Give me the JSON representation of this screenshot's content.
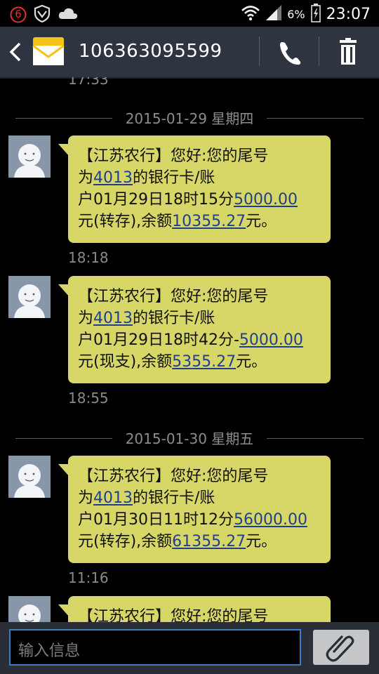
{
  "status_bar": {
    "notification_count": "6",
    "battery_percent": "6%",
    "time": "23:07"
  },
  "header": {
    "sender": "106363095599"
  },
  "conversation": {
    "top_time_partial": "17:33",
    "date_1": "2015-01-29 星期四",
    "date_2": "2015-01-30 星期五",
    "messages": [
      {
        "l1": "【江苏农行】您好:您的尾号",
        "l2_pre": "为",
        "card": "4013",
        "l2_post": "的银行卡/账",
        "l3_pre": "户01月29日18时15分",
        "amount": "5000.00",
        "l4_pre": "元(转存),余额",
        "balance": "10355.27",
        "l4_post": "元。",
        "time": "18:18"
      },
      {
        "l1": "【江苏农行】您好:您的尾号",
        "l2_pre": "为",
        "card": "4013",
        "l2_post": "的银行卡/账",
        "l3_pre": "户01月29日18时42分-",
        "amount": "5000.00",
        "l4_pre": "元(现支),余额",
        "balance": "5355.27",
        "l4_post": "元。",
        "time": "18:55"
      },
      {
        "l1": "【江苏农行】您好:您的尾号",
        "l2_pre": "为",
        "card": "4013",
        "l2_post": "的银行卡/账",
        "l3_pre": "户01月30日11时12分",
        "amount": "56000.00",
        "l4_pre": "元(转存),余额",
        "balance": "61355.27",
        "l4_post": "元。",
        "time": "11:16"
      },
      {
        "l1": "【江苏农行】您好:您的尾号"
      }
    ]
  },
  "composer": {
    "placeholder": "输入信息"
  },
  "icons": {
    "back": "chevron-left-icon",
    "message": "envelope-icon",
    "call": "phone-icon",
    "delete": "trash-icon",
    "attach": "paperclip-icon"
  },
  "colors": {
    "bubble": "#d7d768",
    "header": "#2f3540",
    "link": "#1f3f8e",
    "input_border": "#3a7dc2"
  }
}
